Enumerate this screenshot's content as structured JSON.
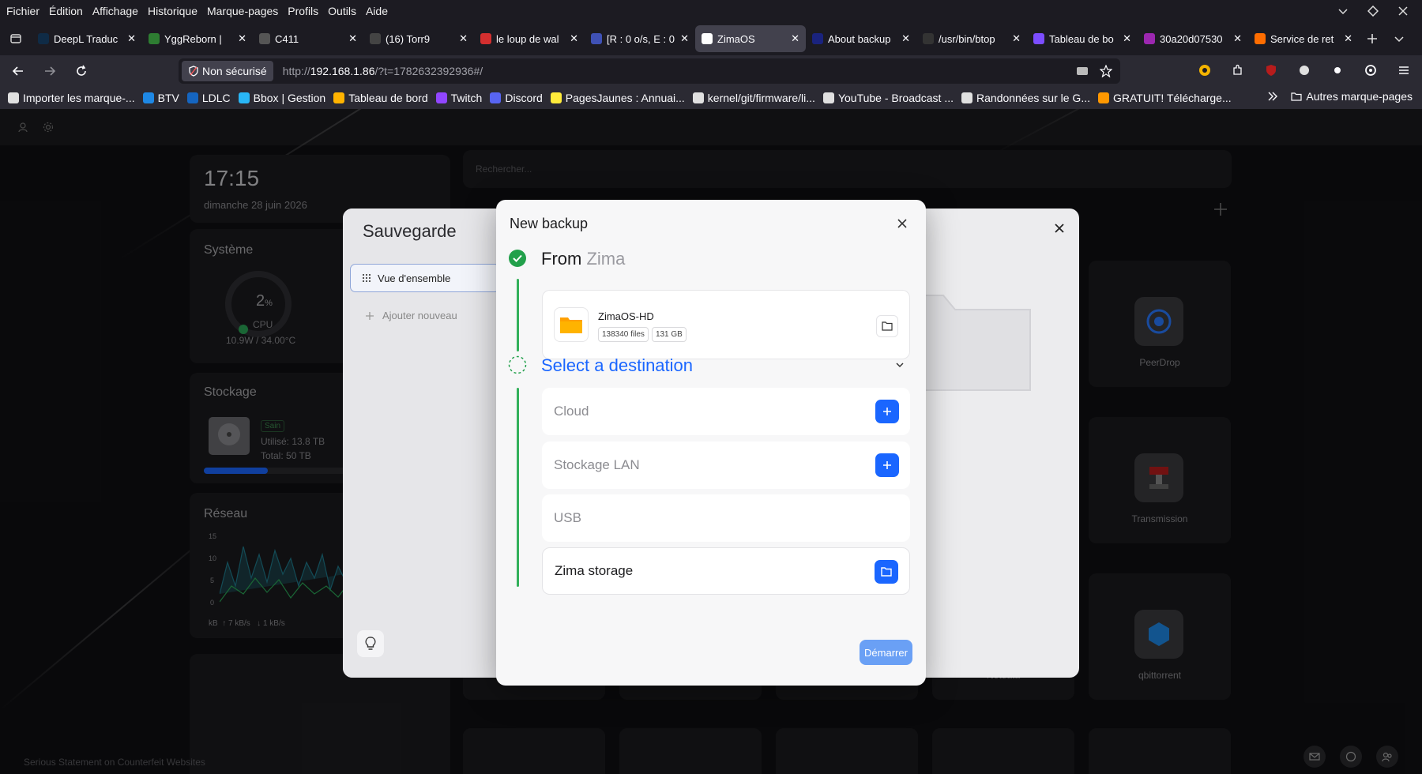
{
  "menubar": {
    "items": [
      "Fichier",
      "Édition",
      "Affichage",
      "Historique",
      "Marque-pages",
      "Profils",
      "Outils",
      "Aide"
    ]
  },
  "tabs": [
    {
      "title": "DeepL Traduc",
      "color": "#0f2b46"
    },
    {
      "title": "YggReborn | ",
      "color": "#2e7d32"
    },
    {
      "title": "C411",
      "color": "#555555"
    },
    {
      "title": "(16) Torr9",
      "color": "#444444"
    },
    {
      "title": "le loup de wal",
      "color": "#d32f2f"
    },
    {
      "title": "[R : 0 o/s, E : 0",
      "color": "#3f51b5"
    },
    {
      "title": "ZimaOS",
      "color": "#ffffff",
      "active": true
    },
    {
      "title": "About backup",
      "color": "#1a237e"
    },
    {
      "title": "/usr/bin/btop",
      "color": "#333333"
    },
    {
      "title": "Tableau de bo",
      "color": "#7c4dff"
    },
    {
      "title": "30a20d07530",
      "color": "#9c27b0"
    },
    {
      "title": "Service de ret",
      "color": "#ff6d00"
    }
  ],
  "navbar": {
    "insecure_label": "Non sécurisé",
    "url_prefix": "http://",
    "url_host": "192.168.1.86",
    "url_rest": "/?t=1782632392936#/"
  },
  "bookmarks": [
    {
      "label": "Importer les marque-...",
      "color": "#e0e0e0"
    },
    {
      "label": "BTV",
      "color": "#1e88e5"
    },
    {
      "label": "LDLC",
      "color": "#1565c0"
    },
    {
      "label": "Bbox | Gestion",
      "color": "#29b6f6"
    },
    {
      "label": "Tableau de bord",
      "color": "#ffb300"
    },
    {
      "label": "Twitch",
      "color": "#9146ff"
    },
    {
      "label": "Discord",
      "color": "#5865f2"
    },
    {
      "label": "PagesJaunes : Annuai...",
      "color": "#ffeb3b"
    },
    {
      "label": "kernel/git/firmware/li...",
      "color": "#e0e0e0"
    },
    {
      "label": "YouTube - Broadcast ...",
      "color": "#e0e0e0"
    },
    {
      "label": "Randonnées sur le G...",
      "color": "#e0e0e0"
    },
    {
      "label": "GRATUIT! Télécharge...",
      "color": "#ff9800"
    }
  ],
  "bookmarks_other": "Autres marque-pages",
  "dashboard": {
    "time": "17:15",
    "date": "dimanche 28 juin 2026",
    "search_placeholder": "Rechercher...",
    "system_title": "Système",
    "cpu_value": "2",
    "cpu_unit": "%",
    "cpu_label": "CPU",
    "cpu_info": "10.9W / 34.00°C",
    "storage_title": "Stockage",
    "storage_badge": "Sain",
    "storage_used": "Utilisé: 13.8 TB",
    "storage_total": "Total: 50 TB",
    "storage_fill": 0.276,
    "network_title": "Réseau",
    "network_ticks": [
      "15",
      "10",
      "5",
      "0"
    ],
    "network_unit": "kB",
    "network_up": "7 kB/s",
    "network_down": "1 kB/s",
    "footer_text": "Serious Statement on Counterfeit Websites",
    "apps": [
      {
        "name": "PeerDrop",
        "color": "#2979ff"
      },
      {
        "name": "Transmission",
        "color": "#b71c1c"
      },
      {
        "name": "qbittorrent",
        "color": "#1e88e5"
      }
    ],
    "netdata_label": "Netdata"
  },
  "sauvegarde": {
    "title": "Sauvegarde",
    "overview_label": "Vue d'ensemble",
    "add_new_label": "Ajouter nouveau"
  },
  "modal": {
    "title": "New backup",
    "from_label": "From",
    "from_name": "Zima",
    "source_name": "ZimaOS-HD",
    "source_files": "138340 files",
    "source_size": "131 GB",
    "select_dest_label": "Select a destination",
    "destinations": [
      {
        "label": "Cloud",
        "action": "add"
      },
      {
        "label": "Stockage LAN",
        "action": "add"
      },
      {
        "label": "USB",
        "action": "none"
      },
      {
        "label": "Zima storage",
        "action": "folder"
      }
    ],
    "start_label": "Démarrer"
  }
}
